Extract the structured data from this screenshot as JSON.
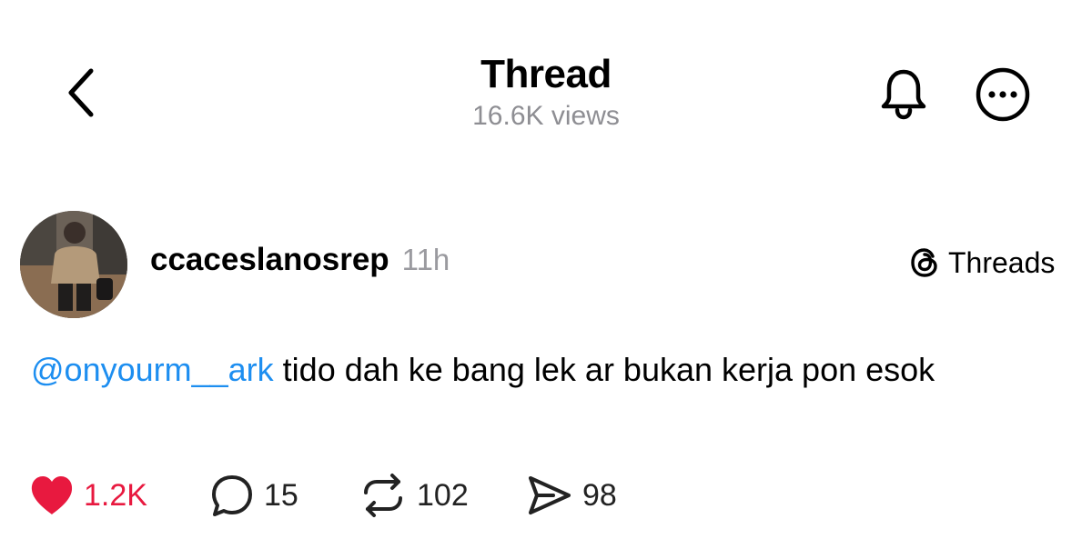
{
  "header": {
    "title": "Thread",
    "views": "16.6K views"
  },
  "post": {
    "username": "ccaceslanosrep",
    "time": "11h",
    "source_label": "Threads",
    "mention": "@onyourm__ark",
    "text": " tido dah ke bang lek ar bukan kerja pon esok"
  },
  "actions": {
    "likes": "1.2K",
    "replies": "15",
    "reposts": "102",
    "shares": "98"
  },
  "colors": {
    "mention": "#1d8ef0",
    "like": "#e8193f",
    "muted": "#8e8e93"
  },
  "icons": [
    "chevron-left-icon",
    "bell-icon",
    "more-icon",
    "threads-logo-icon",
    "heart-icon",
    "comment-icon",
    "repost-icon",
    "send-icon"
  ]
}
